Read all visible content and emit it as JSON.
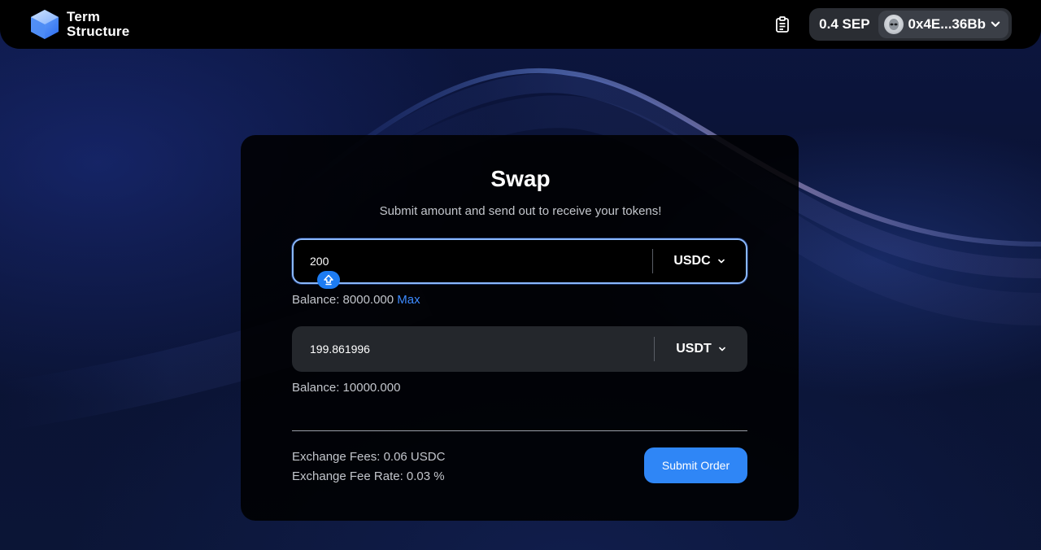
{
  "brand": {
    "name_line1": "Term",
    "name_line2": "Structure"
  },
  "header": {
    "clipboard_icon": "clipboard-list-icon",
    "wallet_balance": "0.4 SEP",
    "address": "0x4E...36Bb",
    "avatar_icon": "alien-avatar-icon",
    "address_chevron_icon": "chevron-down-icon"
  },
  "swap": {
    "title": "Swap",
    "subtitle": "Submit amount and send out to receive your tokens!",
    "from": {
      "amount": "200",
      "token": "USDC",
      "balance_label": "Balance: 8000.000",
      "max_label": "Max"
    },
    "to": {
      "amount": "199.861996",
      "token": "USDT",
      "balance_label": "Balance: 10000.000"
    },
    "swap_toggle_icon": "swap-direction-icon",
    "fees": {
      "exchange_fees": "Exchange Fees: 0.06 USDC",
      "exchange_fee_rate": "Exchange Fee Rate: 0.03 %"
    },
    "submit_label": "Submit Order"
  },
  "colors": {
    "accent": "#2f86f6",
    "link": "#3d8bff",
    "focus_border": "#8ab8ff"
  }
}
